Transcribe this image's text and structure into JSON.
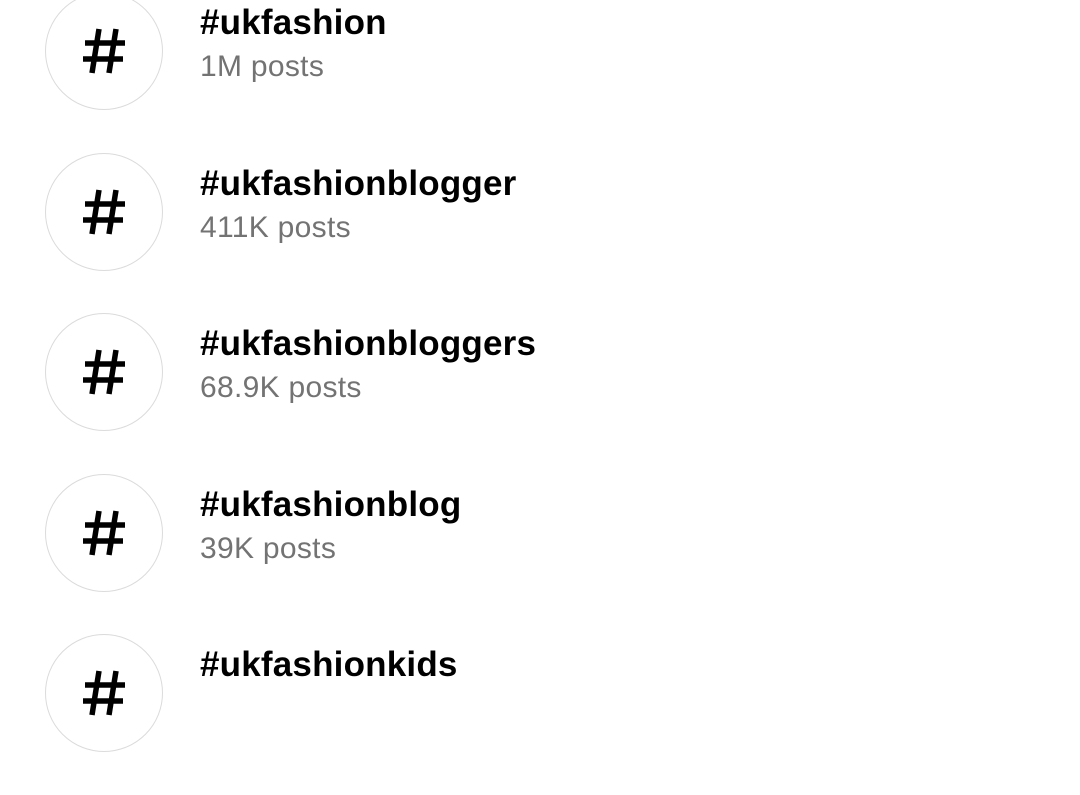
{
  "icon": "hashtag-icon",
  "colors": {
    "tag_text": "#000000",
    "count_text": "#737373",
    "avatar_border": "#dbdbdb"
  },
  "results": [
    {
      "tag": "#ukfashion",
      "count": "1M posts"
    },
    {
      "tag": "#ukfashionblogger",
      "count": "411K posts"
    },
    {
      "tag": "#ukfashionbloggers",
      "count": "68.9K posts"
    },
    {
      "tag": "#ukfashionblog",
      "count": "39K posts"
    },
    {
      "tag": "#ukfashionkids",
      "count": ""
    }
  ]
}
